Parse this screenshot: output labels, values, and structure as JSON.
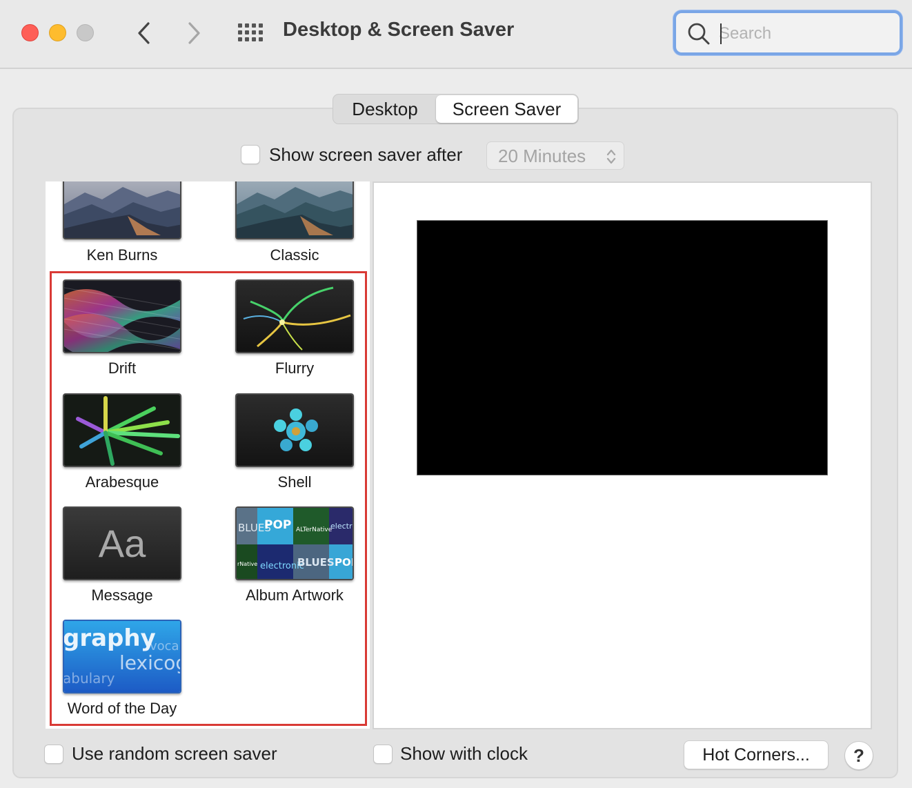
{
  "window": {
    "title": "Desktop & Screen Saver",
    "search_placeholder": "Search"
  },
  "tabs": [
    {
      "label": "Desktop",
      "selected": false
    },
    {
      "label": "Screen Saver",
      "selected": true
    }
  ],
  "show_after": {
    "label": "Show screen saver after",
    "checked": false,
    "value": "20 Minutes"
  },
  "savers": [
    {
      "label": "Ken Burns",
      "thumb": "mountain-photo"
    },
    {
      "label": "Classic",
      "thumb": "mountain-photo"
    },
    {
      "label": "Drift",
      "thumb": "drift-wave"
    },
    {
      "label": "Flurry",
      "thumb": "flurry-streaks"
    },
    {
      "label": "Arabesque",
      "thumb": "arabesque-rays"
    },
    {
      "label": "Shell",
      "thumb": "shell-flower"
    },
    {
      "label": "Message",
      "thumb": "message-aa",
      "thumb_text": "Aa"
    },
    {
      "label": "Album Artwork",
      "thumb": "album-mosaic",
      "tiles": [
        "BLUES",
        "POP",
        "ALTerNative",
        "electronic",
        "electronic",
        "BLUES",
        "POP",
        "rNative"
      ]
    },
    {
      "label": "Word of the Day",
      "thumb": "word-of-day",
      "words": [
        "graphy",
        "voca",
        "lexicog",
        "abulary"
      ]
    }
  ],
  "bottom": {
    "random_label": "Use random screen saver",
    "random_checked": false,
    "clock_label": "Show with clock",
    "clock_checked": false,
    "hot_corners_label": "Hot Corners...",
    "help_label": "?"
  },
  "colors": {
    "highlight": "#d93a35",
    "search_focus": "#7aa6e6",
    "close": "#fe5f57",
    "minimize": "#febc2e",
    "zoom_disabled": "#c8c8c8"
  }
}
